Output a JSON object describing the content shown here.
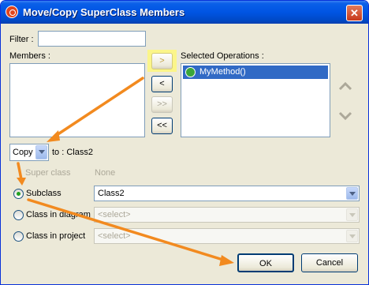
{
  "window": {
    "title": "Move/Copy SuperClass Members"
  },
  "filter": {
    "label": "Filter :",
    "value": ""
  },
  "members": {
    "label": "Members :",
    "items": []
  },
  "move_buttons": {
    "add": ">",
    "remove": "<",
    "add_all": ">>",
    "remove_all": "<<"
  },
  "selected": {
    "label": "Selected Operations :",
    "items": [
      {
        "label": "MyMethod()"
      }
    ]
  },
  "action": {
    "value": "Copy",
    "target_text": "to : Class2"
  },
  "targets": {
    "super": {
      "label": "Super class",
      "value": "None"
    },
    "subclass": {
      "label": "Subclass",
      "value": "Class2"
    },
    "diagram": {
      "label": "Class in diagram",
      "value": "<select>"
    },
    "project": {
      "label": "Class in project",
      "value": "<select>"
    }
  },
  "buttons": {
    "ok": "OK",
    "cancel": "Cancel"
  },
  "colors": {
    "annotation_arrow": "#f28a1f",
    "highlight": "#fbf58a",
    "selection": "#316ac5"
  },
  "icons": [
    "close-icon",
    "move-up-icon",
    "move-down-icon",
    "method-icon"
  ]
}
